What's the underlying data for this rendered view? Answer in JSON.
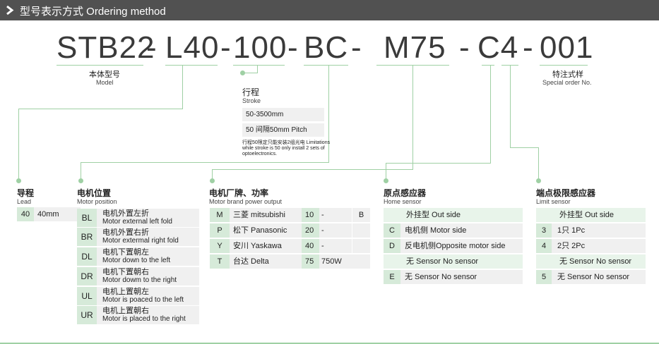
{
  "header": {
    "title": "型号表示方式 Ordering method"
  },
  "code": {
    "parts": [
      "STB22",
      "L40",
      "100",
      "BC",
      "M75",
      "C4",
      "001"
    ],
    "dash": "-"
  },
  "model_caption": {
    "zh": "本体型号",
    "en": "Model"
  },
  "special_caption": {
    "zh": "特注式样",
    "en": "Special order No."
  },
  "stroke": {
    "zh": "行程",
    "en": "Stroke",
    "rows": [
      "50-3500mm",
      "50 间隔50mm Pitch"
    ],
    "note": "行程50限定只能安装2组光电 Limitations while stroke is 50 only install 2 sets of optoelectronics."
  },
  "lead": {
    "zh": "导程",
    "en": "Lead",
    "rows": [
      {
        "code": "40",
        "value": "40mm"
      }
    ]
  },
  "motor_position": {
    "zh": "电机位置",
    "en": "Motor position",
    "rows": [
      {
        "code": "BL",
        "zh": "电机外置左折",
        "en": "Motor external left fold"
      },
      {
        "code": "BR",
        "zh": "电机外置右折",
        "en": "Motor extermal right fold"
      },
      {
        "code": "DL",
        "zh": "电机下置朝左",
        "en": "Motor down to the left"
      },
      {
        "code": "DR",
        "zh": "电机下置朝右",
        "en": "Motor dowm to the right"
      },
      {
        "code": "UL",
        "zh": "电机上置朝左",
        "en": "Motor is poaced to the left"
      },
      {
        "code": "UR",
        "zh": "电机上置朝右",
        "en": "Motor is placed to the right"
      }
    ]
  },
  "motor_brand": {
    "zh": "电机厂牌、功率",
    "en": "Motor brand   power output",
    "rows": [
      {
        "code": "M",
        "brand": "三菱  mitsubishi",
        "power_code": "10",
        "power": "-",
        "extra": "B"
      },
      {
        "code": "P",
        "brand": "松下  Panasonic",
        "power_code": "20",
        "power": "-",
        "extra": ""
      },
      {
        "code": "Y",
        "brand": "安川  Yaskawa",
        "power_code": "40",
        "power": "-",
        "extra": ""
      },
      {
        "code": "T",
        "brand": "台达  Delta",
        "power_code": "75",
        "power": "750W",
        "extra": ""
      }
    ]
  },
  "home_sensor": {
    "zh": "原点感应器",
    "en": "Home sensor",
    "rows": [
      {
        "code": "",
        "label": "外挂型 Out side"
      },
      {
        "code": "C",
        "label": "电机侧  Motor side"
      },
      {
        "code": "D",
        "label": "反电机侧Opposite motor side"
      },
      {
        "code": "",
        "label": "无 Sensor No sensor"
      },
      {
        "code": "E",
        "label": "无 Sensor No sensor"
      }
    ]
  },
  "limit_sensor": {
    "zh": "端点极限感应器",
    "en": "Limit sensor",
    "rows": [
      {
        "code": "",
        "label": "外挂型 Out side"
      },
      {
        "code": "3",
        "label": "1只  1Pc"
      },
      {
        "code": "4",
        "label": "2只  2Pc"
      },
      {
        "code": "",
        "label": "无 Sensor No sensor"
      },
      {
        "code": "5",
        "label": "无 Sensor No sensor"
      }
    ]
  }
}
